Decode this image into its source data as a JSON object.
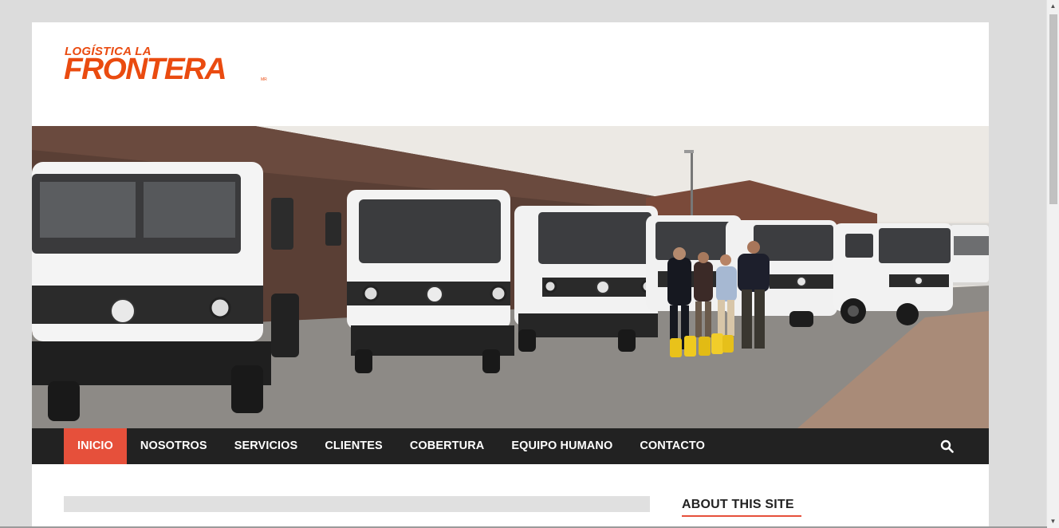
{
  "brand": {
    "line1": "LOGÍSTICA LA",
    "line2": "FRONTERA",
    "mark": "MR",
    "color": "#ea4b10"
  },
  "nav": {
    "items": [
      "INICIO",
      "NOSOTROS",
      "SERVICIOS",
      "CLIENTES",
      "COBERTURA",
      "EQUIPO HUMANO",
      "CONTACTO"
    ],
    "active": "INICIO",
    "active_color": "#e6503b",
    "background": "#222222",
    "search_icon": "search-icon"
  },
  "sidebar": {
    "widget_title": "ABOUT THIS SITE"
  }
}
